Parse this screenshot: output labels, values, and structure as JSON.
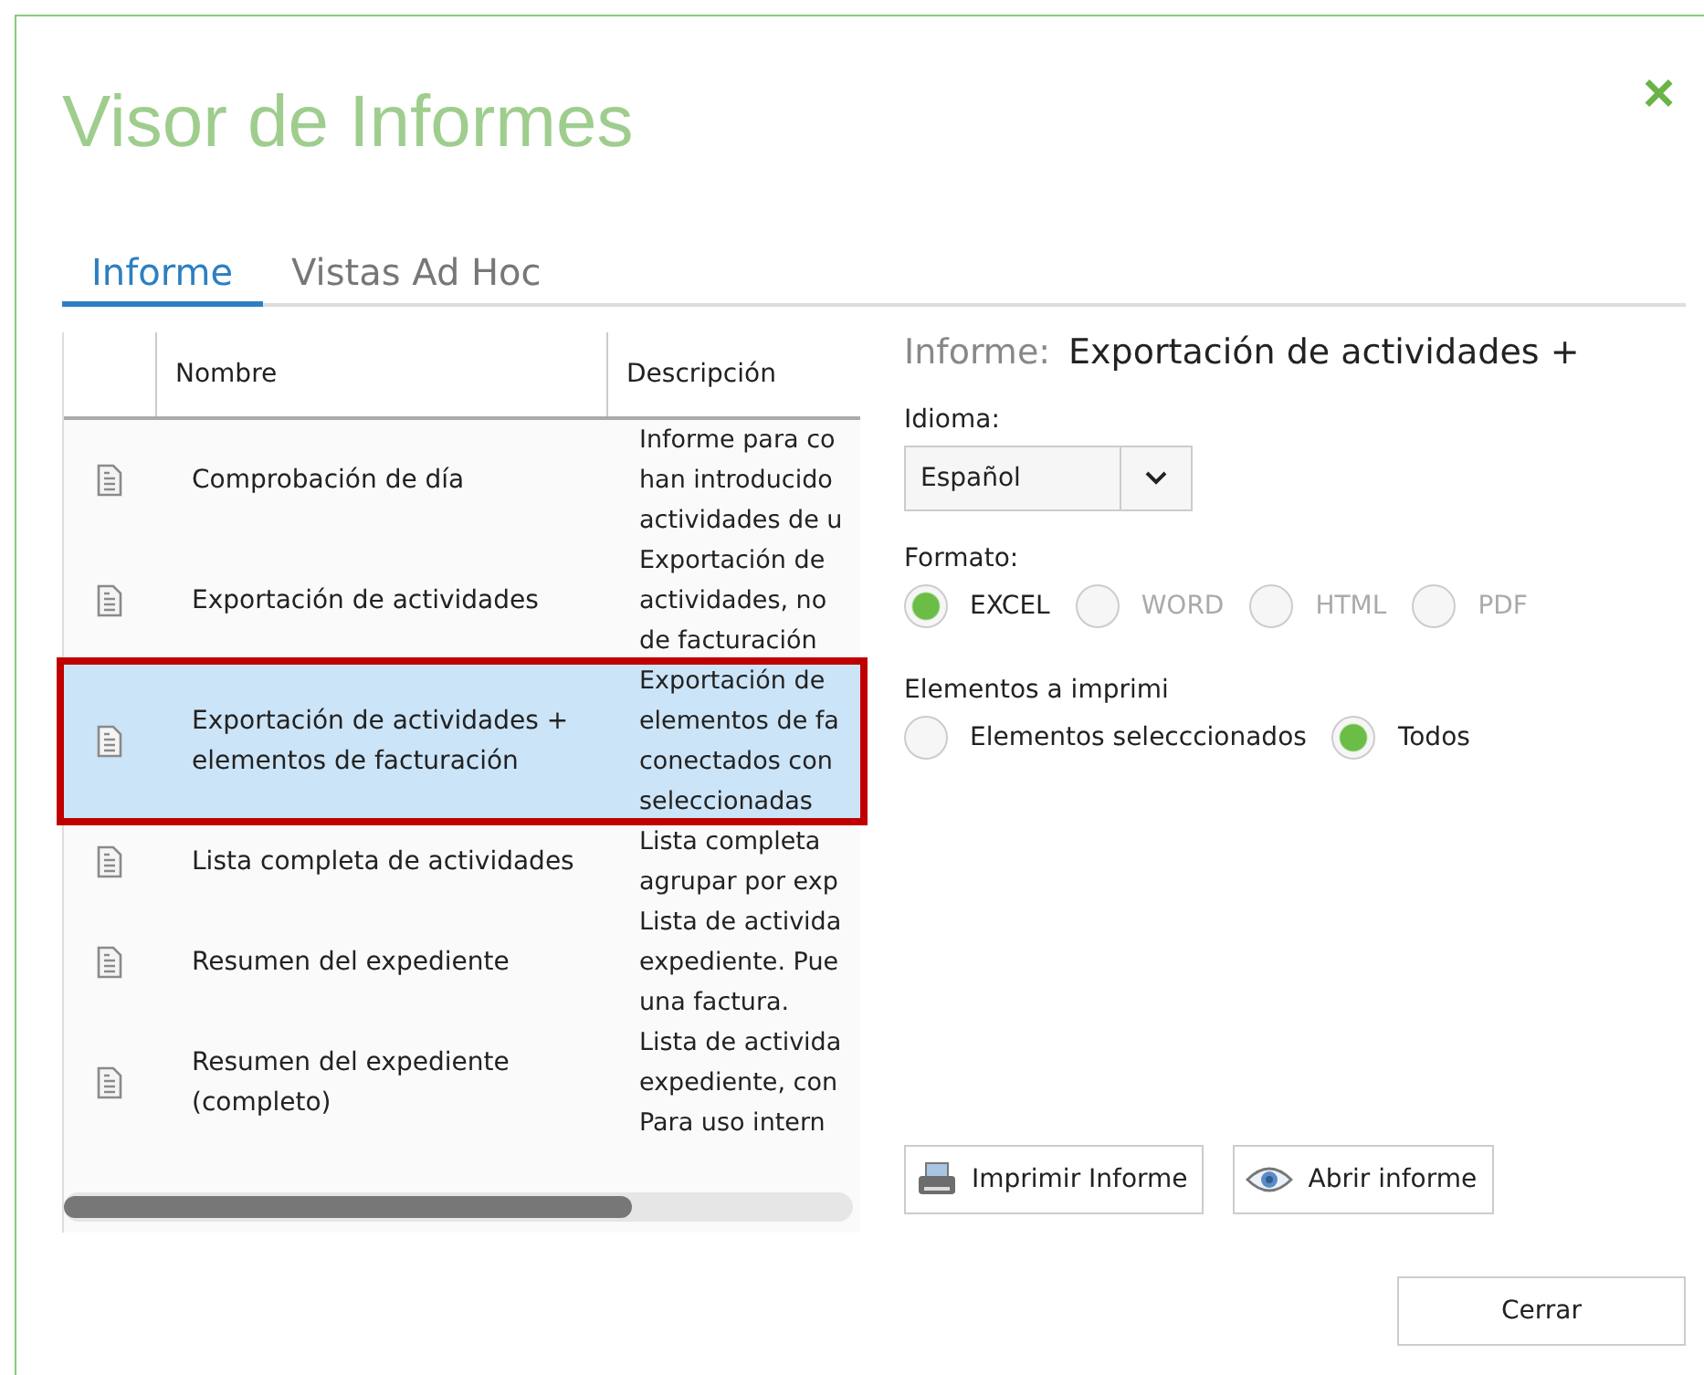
{
  "window": {
    "title": "Visor de Informes",
    "close": "×"
  },
  "tabs": [
    {
      "label": "Informe",
      "selected": true
    },
    {
      "label": "Vistas Ad Hoc",
      "selected": false
    }
  ],
  "table": {
    "columns": [
      "Nombre",
      "Descripción"
    ],
    "rows": [
      {
        "name": [
          "Comprobación de día"
        ],
        "description": [
          "Informe para co",
          "han introducido",
          "actividades de u"
        ],
        "selected": false,
        "highlighted": false
      },
      {
        "name": [
          "Exportación de actividades"
        ],
        "description": [
          "Exportación de",
          "actividades, no",
          "de facturación"
        ],
        "selected": false,
        "highlighted": false
      },
      {
        "name": [
          "Exportación de actividades +",
          "elementos de facturación"
        ],
        "description": [
          "Exportación de",
          "elementos de fa",
          "conectados con",
          "seleccionadas"
        ],
        "selected": true,
        "highlighted": true
      },
      {
        "name": [
          "Lista completa de actividades"
        ],
        "description": [
          "Lista completa",
          "agrupar por exp"
        ],
        "selected": false,
        "highlighted": false
      },
      {
        "name": [
          "Resumen del expediente"
        ],
        "description": [
          "Lista de activida",
          "expediente. Pue",
          "una factura."
        ],
        "selected": false,
        "highlighted": false
      },
      {
        "name": [
          "Resumen del expediente",
          "(completo)"
        ],
        "description": [
          "Lista de activida",
          "expediente, con",
          "Para uso intern"
        ],
        "selected": false,
        "highlighted": false
      }
    ]
  },
  "details": {
    "label": "Informe:",
    "value": "Exportación de actividades +",
    "language": {
      "label": "Idioma:",
      "value": "Español"
    },
    "format": {
      "label": "Formato:",
      "options": [
        {
          "label": "EXCEL",
          "selected": true,
          "disabled": false
        },
        {
          "label": "WORD",
          "selected": false,
          "disabled": true
        },
        {
          "label": "HTML",
          "selected": false,
          "disabled": true
        },
        {
          "label": "PDF",
          "selected": false,
          "disabled": true
        }
      ]
    },
    "elements": {
      "label": "Elementos a imprimi",
      "options": [
        {
          "label": "Elementos selecccionados",
          "selected": false,
          "disabled": false
        },
        {
          "label": "Todos",
          "selected": true,
          "disabled": false
        }
      ]
    },
    "actions": [
      {
        "kind": "print",
        "label": "Imprimir Informe"
      },
      {
        "kind": "open",
        "label": "Abrir informe"
      }
    ]
  },
  "footer": {
    "button": "Cerrar"
  }
}
